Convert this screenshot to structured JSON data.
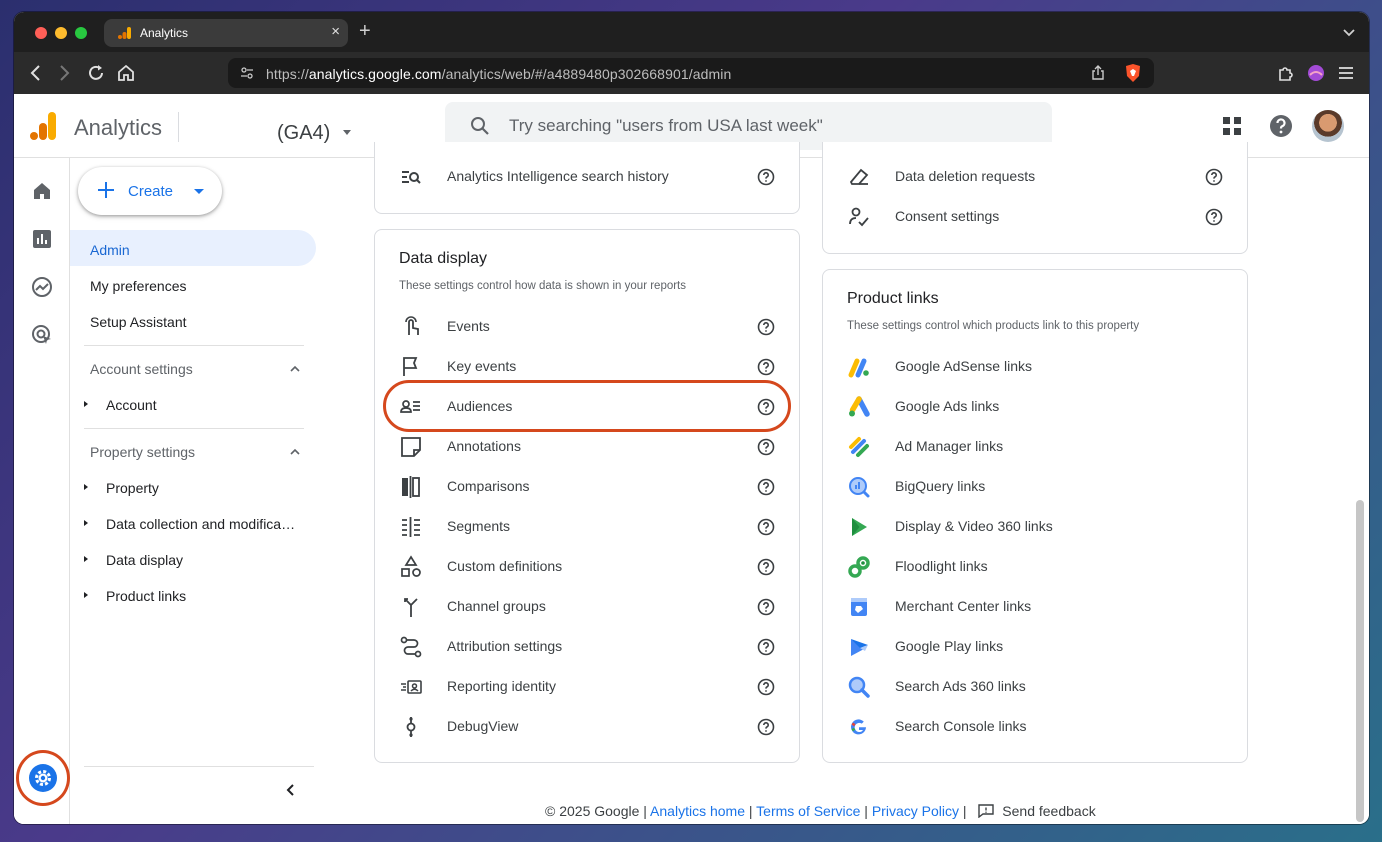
{
  "browser": {
    "tab_title": "Analytics",
    "tab_close": "×",
    "new_tab": "+",
    "url_prefix": "https://",
    "url_host": "analytics.google.com",
    "url_path": "/analytics/web/#/a4889480p302668901/admin"
  },
  "appbar": {
    "app_name": "Analytics",
    "property_label": "(GA4)",
    "search_placeholder": "Try searching \"users from USA last week\""
  },
  "nav": {
    "create_label": "Create",
    "items": [
      "Admin",
      "My preferences",
      "Setup Assistant"
    ],
    "active_item": "Admin",
    "account_section": "Account settings",
    "account_items": [
      "Account"
    ],
    "property_section": "Property settings",
    "property_items": [
      "Property",
      "Data collection and modifica…",
      "Data display",
      "Product links"
    ]
  },
  "top_left_card": {
    "rows": [
      {
        "label": "Analytics Intelligence search history",
        "icon": "search-history-icon"
      }
    ]
  },
  "top_right_card": {
    "rows": [
      {
        "label": "Data deletion requests",
        "icon": "eraser-icon"
      },
      {
        "label": "Consent settings",
        "icon": "consent-icon"
      }
    ]
  },
  "data_display": {
    "title": "Data display",
    "subtitle": "These settings control how data is shown in your reports",
    "highlighted": "Audiences",
    "rows": [
      {
        "label": "Events",
        "icon": "touch-icon"
      },
      {
        "label": "Key events",
        "icon": "flag-icon"
      },
      {
        "label": "Audiences",
        "icon": "audience-icon"
      },
      {
        "label": "Annotations",
        "icon": "note-icon"
      },
      {
        "label": "Comparisons",
        "icon": "compare-icon"
      },
      {
        "label": "Segments",
        "icon": "segment-icon"
      },
      {
        "label": "Custom definitions",
        "icon": "shapes-icon"
      },
      {
        "label": "Channel groups",
        "icon": "merge-icon"
      },
      {
        "label": "Attribution settings",
        "icon": "route-icon"
      },
      {
        "label": "Reporting identity",
        "icon": "identity-icon"
      },
      {
        "label": "DebugView",
        "icon": "debug-icon"
      }
    ]
  },
  "product_links": {
    "title": "Product links",
    "subtitle": "These settings control which products link to this property",
    "rows": [
      {
        "label": "Google AdSense links",
        "icon": "adsense-icon"
      },
      {
        "label": "Google Ads links",
        "icon": "google-ads-icon"
      },
      {
        "label": "Ad Manager links",
        "icon": "ad-manager-icon"
      },
      {
        "label": "BigQuery links",
        "icon": "bigquery-icon"
      },
      {
        "label": "Display & Video 360 links",
        "icon": "dv360-icon"
      },
      {
        "label": "Floodlight links",
        "icon": "floodlight-icon"
      },
      {
        "label": "Merchant Center links",
        "icon": "merchant-center-icon"
      },
      {
        "label": "Google Play links",
        "icon": "google-play-icon"
      },
      {
        "label": "Search Ads 360 links",
        "icon": "search-ads-icon"
      },
      {
        "label": "Search Console links",
        "icon": "search-console-icon"
      }
    ]
  },
  "footer": {
    "copyright": "© 2025 Google",
    "sep": "|",
    "links": [
      "Analytics home",
      "Terms of Service",
      "Privacy Policy"
    ],
    "feedback": "Send feedback"
  },
  "colors": {
    "accent_blue": "#1a73e8",
    "highlight_ring": "#d5481d",
    "active_nav_bg": "#e8f0fe"
  }
}
